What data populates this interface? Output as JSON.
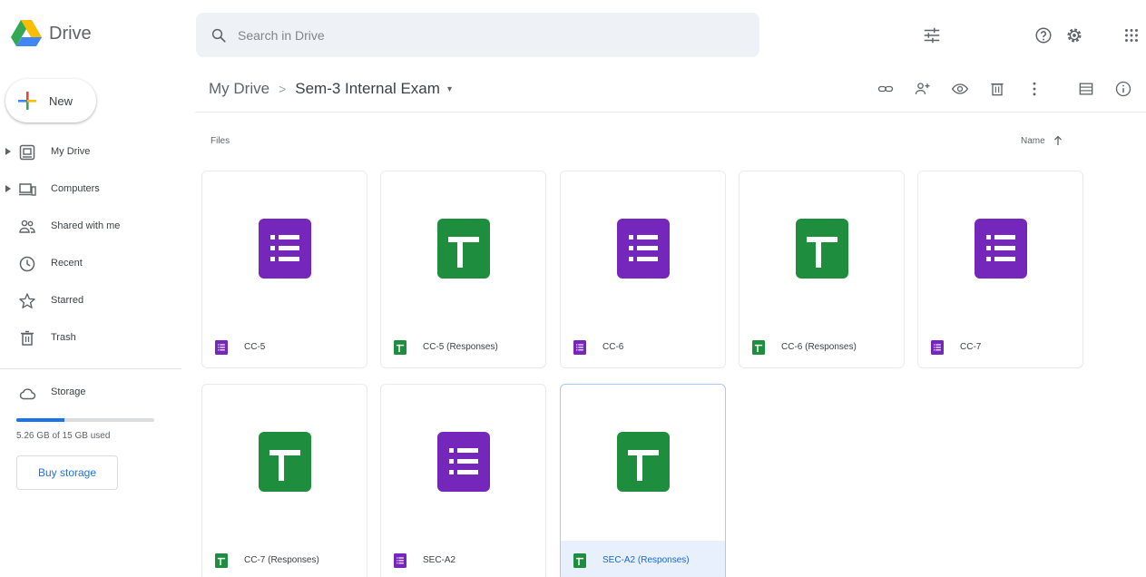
{
  "app": {
    "logo_text": "Drive"
  },
  "search": {
    "placeholder": "Search in Drive"
  },
  "sidebar": {
    "new_label": "New",
    "items": [
      {
        "label": "My Drive",
        "icon": "my-drive-icon"
      },
      {
        "label": "Computers",
        "icon": "computers-icon"
      },
      {
        "label": "Shared with me",
        "icon": "shared-icon"
      },
      {
        "label": "Recent",
        "icon": "clock-icon"
      },
      {
        "label": "Starred",
        "icon": "star-icon"
      },
      {
        "label": "Trash",
        "icon": "trash-icon"
      }
    ],
    "storage_label": "Storage",
    "storage_used_fraction": 0.35,
    "storage_text": "5.26 GB of 15 GB used",
    "buy_storage": "Buy storage"
  },
  "breadcrumb": {
    "root": "My Drive",
    "current": "Sem-3 Internal Exam"
  },
  "content": {
    "section_label": "Files",
    "sort_label": "Name",
    "files": [
      {
        "name": "CC-5",
        "type": "form"
      },
      {
        "name": "CC-5 (Responses)",
        "type": "sheet"
      },
      {
        "name": "CC-6",
        "type": "form"
      },
      {
        "name": "CC-6 (Responses)",
        "type": "sheet"
      },
      {
        "name": "CC-7",
        "type": "form"
      },
      {
        "name": "CC-7 (Responses)",
        "type": "sheet"
      },
      {
        "name": "SEC-A2",
        "type": "form"
      },
      {
        "name": "SEC-A2 (Responses)",
        "type": "sheet",
        "selected": true
      }
    ]
  },
  "colors": {
    "form": "#7627bb",
    "sheet": "#1e8e3e",
    "accent": "#1a73e8"
  }
}
